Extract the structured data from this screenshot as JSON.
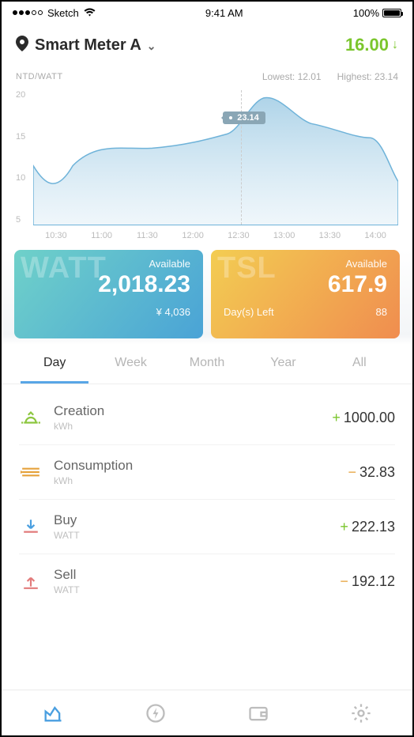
{
  "status": {
    "carrier": "Sketch",
    "time": "9:41 AM",
    "battery": "100%"
  },
  "header": {
    "meter_name": "Smart Meter A",
    "value": "16.00"
  },
  "chart_data": {
    "type": "area",
    "title": "",
    "unit_label": "NTD/WATT",
    "lowest_label": "Lowest: ",
    "lowest_value": "12.01",
    "highest_label": "Highest: ",
    "highest_value": "23.14",
    "ylabel": "",
    "xlabel": "",
    "ylim": [
      0,
      20
    ],
    "categories": [
      "10:30",
      "11:00",
      "11:30",
      "12:00",
      "12:30",
      "13:00",
      "13:30",
      "14:00"
    ],
    "y_ticks": [
      "20",
      "15",
      "10",
      "5"
    ],
    "series": [
      {
        "name": "price",
        "values": [
          10,
          7.5,
          12,
          12,
          13,
          14.5,
          23.14,
          18,
          19,
          15,
          14.5,
          8
        ]
      }
    ],
    "callout": {
      "x": "12:40",
      "value": "23.14"
    }
  },
  "cards": {
    "watt": {
      "bg": "WATT",
      "available_label": "Available",
      "value": "2,018.23",
      "sub_left": "",
      "sub_right": "¥ 4,036"
    },
    "tsl": {
      "bg": "TSL",
      "available_label": "Available",
      "value": "617.9",
      "sub_left": "Day(s) Left",
      "sub_right": "88"
    }
  },
  "tabs": [
    "Day",
    "Week",
    "Month",
    "Year",
    "All"
  ],
  "active_tab": "Day",
  "rows": [
    {
      "icon": "sunrise-icon",
      "title": "Creation",
      "unit": "kWh",
      "sign": "+",
      "value": "1000.00"
    },
    {
      "icon": "lines-icon",
      "title": "Consumption",
      "unit": "kWh",
      "sign": "−",
      "value": "32.83"
    },
    {
      "icon": "download-icon",
      "title": "Buy",
      "unit": "WATT",
      "sign": "+",
      "value": "222.13"
    },
    {
      "icon": "upload-icon",
      "title": "Sell",
      "unit": "WATT",
      "sign": "−",
      "value": "192.12"
    }
  ],
  "colors": {
    "accent_green": "#7bc62d",
    "accent_blue": "#4a9fe0",
    "accent_orange": "#e6a23c"
  }
}
